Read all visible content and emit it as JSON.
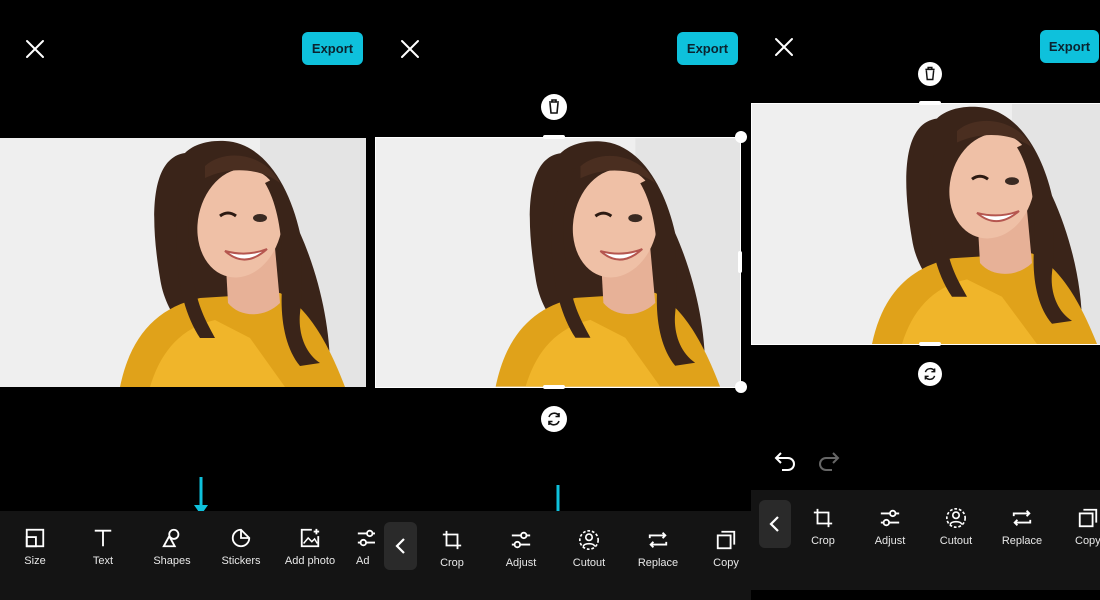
{
  "export_label": "Export",
  "colors": {
    "accent": "#0ec1dc",
    "toolbar_bg": "#141414"
  },
  "screen1": {
    "tools": [
      {
        "label": "Size",
        "icon": "size-icon"
      },
      {
        "label": "Text",
        "icon": "text-icon"
      },
      {
        "label": "Shapes",
        "icon": "shapes-icon"
      },
      {
        "label": "Stickers",
        "icon": "stickers-icon"
      },
      {
        "label": "Add photo",
        "icon": "add-photo-icon"
      },
      {
        "label": "Ad",
        "icon": "adjust-icon"
      }
    ]
  },
  "screen2": {
    "tools": [
      {
        "label": "Crop",
        "icon": "crop-icon"
      },
      {
        "label": "Adjust",
        "icon": "adjust-icon"
      },
      {
        "label": "Cutout",
        "icon": "cutout-icon"
      },
      {
        "label": "Replace",
        "icon": "replace-icon"
      },
      {
        "label": "Copy",
        "icon": "copy-icon"
      }
    ]
  },
  "screen3": {
    "tools": [
      {
        "label": "Crop",
        "icon": "crop-icon"
      },
      {
        "label": "Adjust",
        "icon": "adjust-icon"
      },
      {
        "label": "Cutout",
        "icon": "cutout-icon"
      },
      {
        "label": "Replace",
        "icon": "replace-icon"
      },
      {
        "label": "Copy",
        "icon": "copy-icon"
      }
    ]
  }
}
